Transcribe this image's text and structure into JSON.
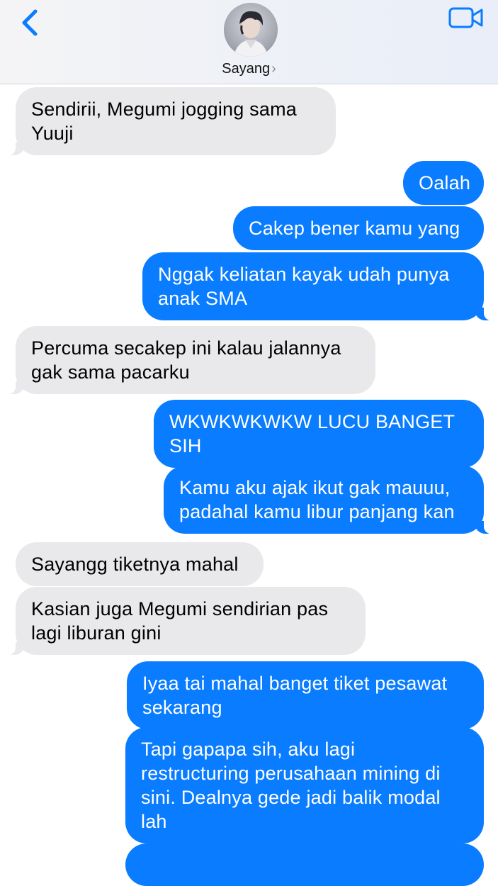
{
  "header": {
    "contact_name": "Sayang",
    "chevron": "›",
    "back_icon": "chevron-left-icon",
    "video_icon": "video-camera-icon",
    "accent_color": "#0a7cff"
  },
  "messages": [
    {
      "direction": "incoming",
      "text": "Sendirii, Megumi jogging sama Yuuji"
    },
    {
      "direction": "outgoing",
      "text": "Oalah"
    },
    {
      "direction": "outgoing",
      "text": "Cakep bener kamu yang"
    },
    {
      "direction": "outgoing",
      "text": "Nggak keliatan kayak udah punya anak SMA"
    },
    {
      "direction": "incoming",
      "text": "Percuma secakep ini kalau jalannya gak sama pacarku"
    },
    {
      "direction": "outgoing",
      "text": "WKWKWKWKW LUCU BANGET SIH"
    },
    {
      "direction": "outgoing",
      "text": "Kamu aku ajak ikut gak mauuu, padahal kamu libur panjang kan"
    },
    {
      "direction": "incoming",
      "text": "Sayangg tiketnya mahal"
    },
    {
      "direction": "incoming",
      "text": "Kasian juga Megumi sendirian pas lagi liburan gini"
    },
    {
      "direction": "outgoing",
      "text": "Iyaa tai mahal banget tiket pesawat sekarang"
    },
    {
      "direction": "outgoing",
      "text": "Tapi gapapa sih, aku lagi restructuring perusahaan mining di sini. Dealnya gede jadi balik modal lah"
    }
  ],
  "colors": {
    "incoming_bubble": "#e9e9eb",
    "outgoing_bubble": "#0a7cff"
  }
}
